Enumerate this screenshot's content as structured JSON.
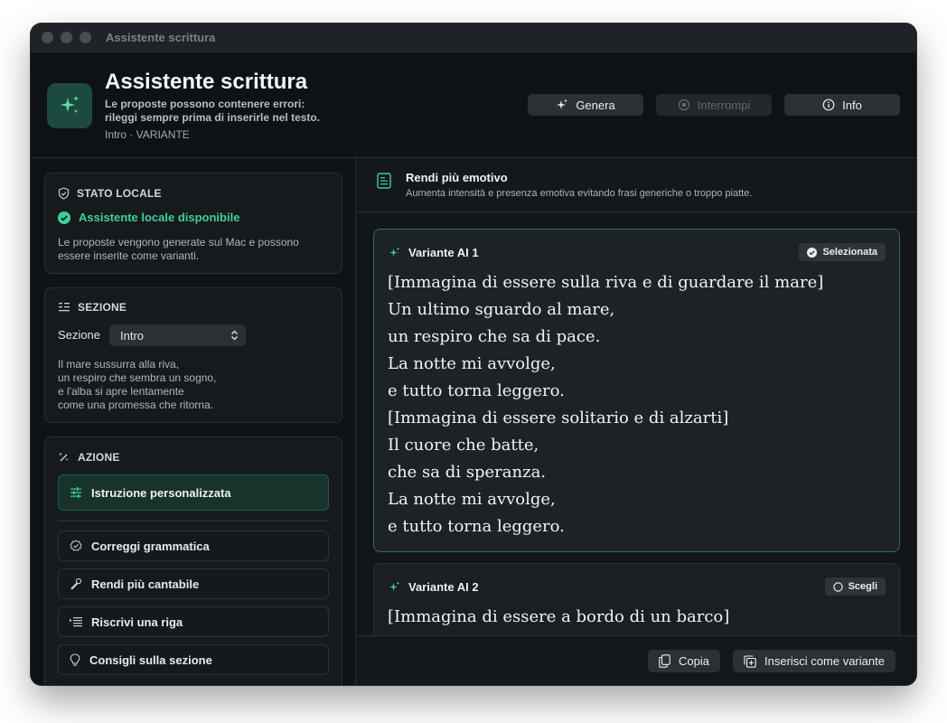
{
  "window": {
    "title": "Assistente scrittura"
  },
  "header": {
    "title": "Assistente scrittura",
    "subtitle": "Le proposte possono contenere errori: rileggi sempre prima di inserirle nel testo.",
    "breadcrumb": "Intro · VARIANTE",
    "buttons": {
      "generate": "Genera",
      "stop": "Interrompi",
      "info": "Info"
    }
  },
  "sidebar": {
    "status": {
      "title": "STATO LOCALE",
      "ok_text": "Assistente locale disponibile",
      "description": "Le proposte vengono generate sul Mac e possono essere inserite come varianti."
    },
    "section": {
      "title": "SEZIONE",
      "label": "Sezione",
      "selected": "Intro",
      "preview_lines": [
        "Il mare sussurra alla riva,",
        "un respiro che sembra un sogno,",
        "e l'alba si apre lentamente",
        "come una promessa che ritorna."
      ]
    },
    "action": {
      "title": "AZIONE",
      "primary": "Istruzione personalizzata",
      "items": [
        "Correggi grammatica",
        "Rendi più cantabile",
        "Riscrivi una riga",
        "Consigli sulla sezione"
      ]
    }
  },
  "main": {
    "mode_title": "Rendi più emotivo",
    "mode_description": "Aumenta intensità e presenza emotiva evitando frasi generiche o troppo piatte.",
    "variants": [
      {
        "title": "Variante AI 1",
        "badge": "Selezionata",
        "lines": [
          "[Immagina di essere sulla riva e di guardare il mare]",
          "Un ultimo sguardo al mare,",
          "un respiro che sa di pace.",
          "La notte mi avvolge,",
          "e tutto torna leggero.",
          "[Immagina di essere solitario e di alzarti]",
          "Il cuore che batte,",
          "che sa di speranza.",
          "La notte mi avvolge,",
          "e tutto torna leggero."
        ]
      },
      {
        "title": "Variante AI 2",
        "badge": "Scegli",
        "lines": [
          "[Immagina di essere a bordo di un barco]"
        ]
      }
    ],
    "footer": {
      "copy": "Copia",
      "insert": "Inserisci come variante"
    }
  },
  "colors": {
    "accent": "#3fcf9a",
    "selected_border": "#2e6b5b",
    "background": "#15181b"
  }
}
